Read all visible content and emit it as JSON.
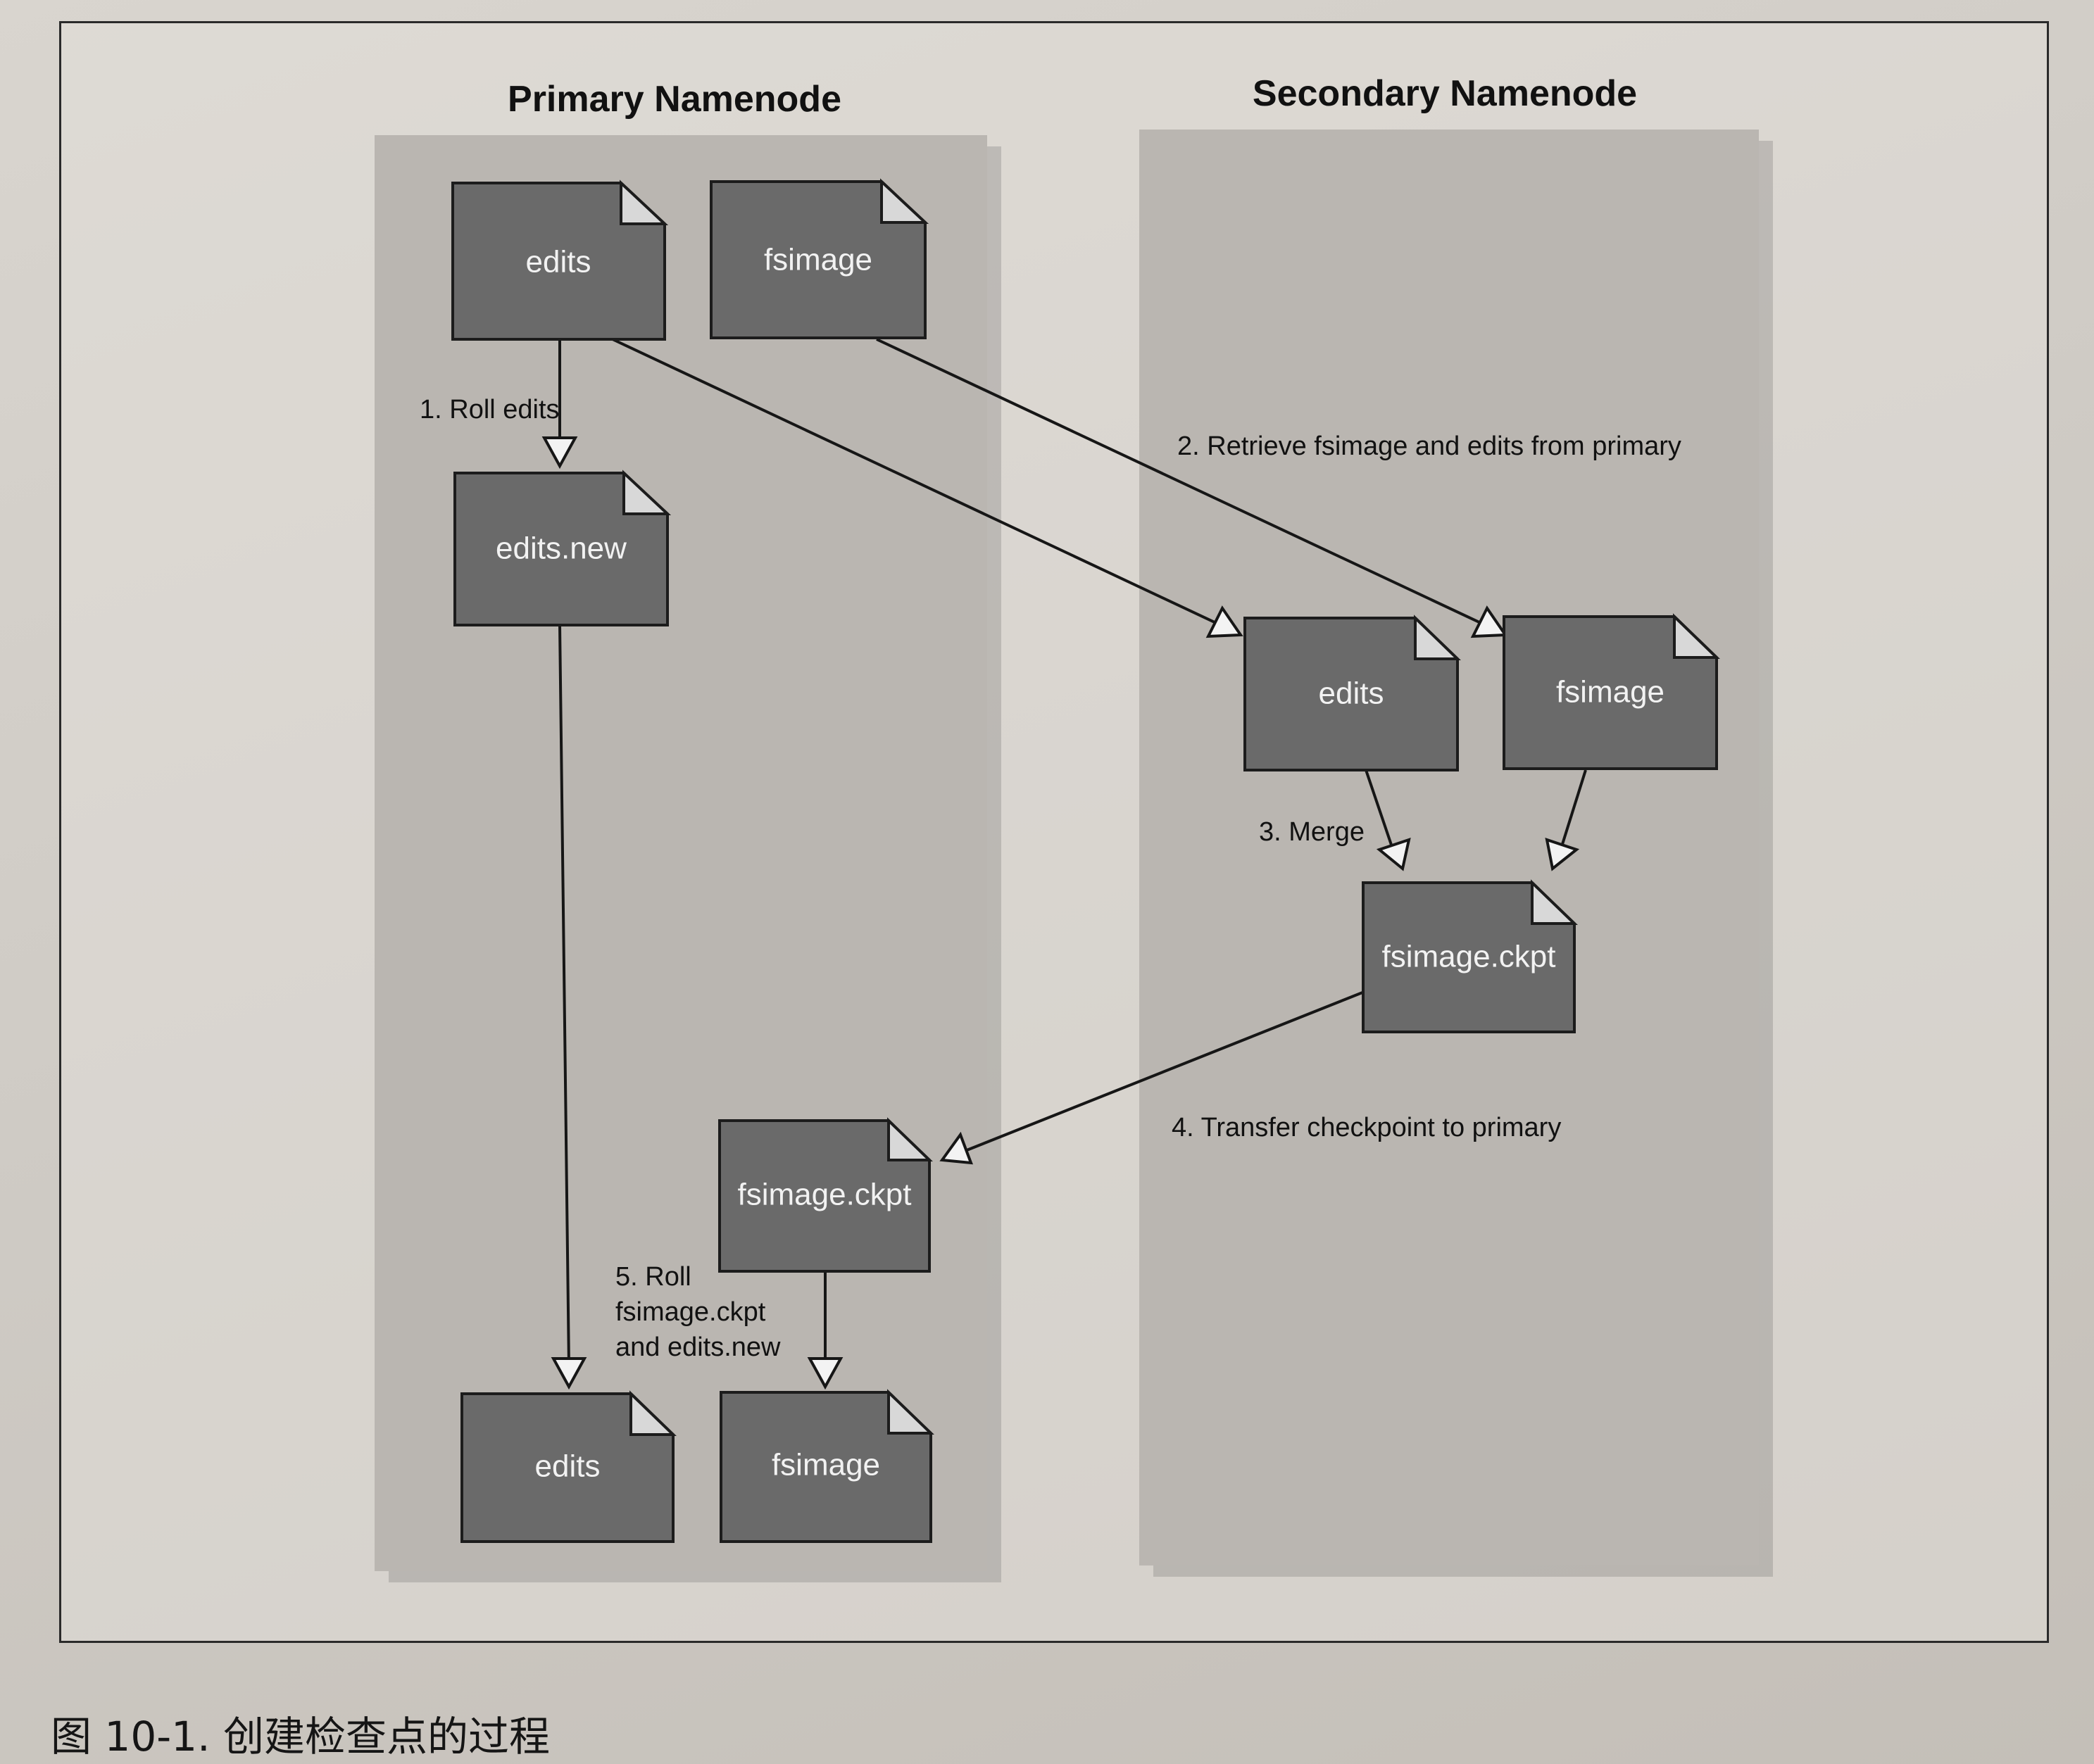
{
  "headings": {
    "primary": "Primary Namenode",
    "secondary": "Secondary Namenode"
  },
  "files": {
    "primary_edits": "edits",
    "primary_fsimage": "fsimage",
    "primary_edits_new": "edits.new",
    "primary_fsimage_ckpt": "fsimage.ckpt",
    "primary_final_edits": "edits",
    "primary_final_fsimage": "fsimage",
    "secondary_edits": "edits",
    "secondary_fsimage": "fsimage",
    "secondary_fsimage_ckpt": "fsimage.ckpt"
  },
  "steps": {
    "roll_edits": "1. Roll edits",
    "retrieve": "2. Retrieve fsimage and edits from primary",
    "merge": "3. Merge",
    "transfer": "4. Transfer checkpoint to primary",
    "roll_final_line1": "5. Roll",
    "roll_final_line2": "fsimage.ckpt",
    "roll_final_line3": "and edits.new"
  },
  "caption": "图 10-1. 创建检查点的过程",
  "colors": {
    "panel": "#bab6b1",
    "file_fill": "#6a6a6a",
    "file_text": "#f2f2f2",
    "ink": "#161616"
  }
}
